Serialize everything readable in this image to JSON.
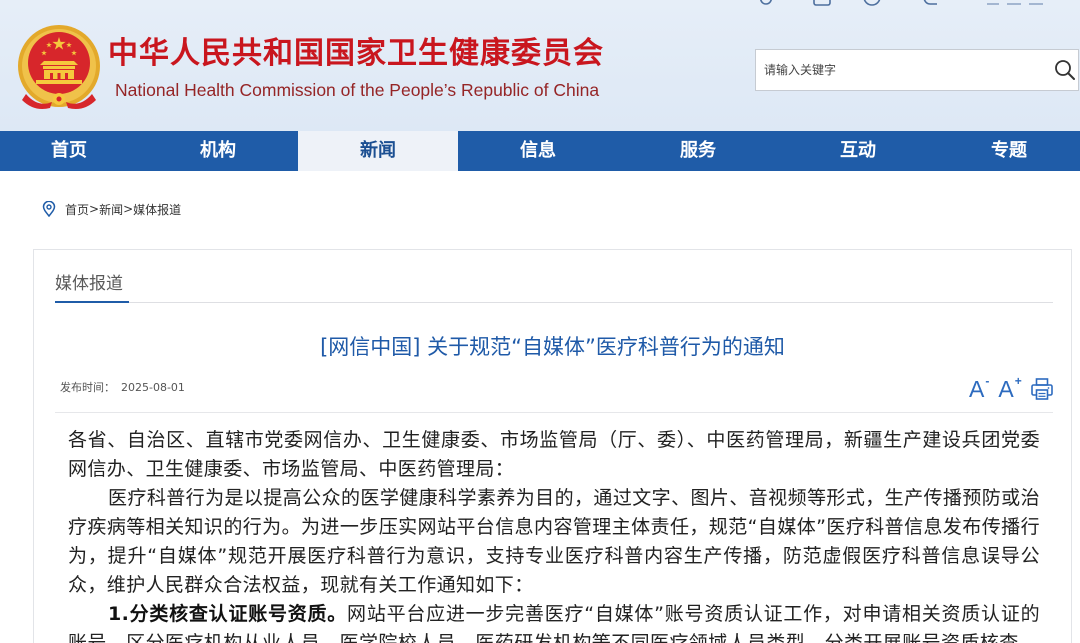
{
  "header": {
    "emblem_icon": "national-emblem-icon",
    "title_cn": "中华人民共和国国家卫生健康委员会",
    "title_en": "National Health Commission of the People’s Republic of China"
  },
  "search": {
    "placeholder": "请输入关键字",
    "icon": "search-icon"
  },
  "nav": {
    "items": [
      {
        "label": "首页"
      },
      {
        "label": "机构"
      },
      {
        "label": "新闻",
        "active": true
      },
      {
        "label": "信息"
      },
      {
        "label": "服务"
      },
      {
        "label": "互动"
      },
      {
        "label": "专题"
      }
    ]
  },
  "breadcrumb": {
    "icon": "location-pin-icon",
    "items": [
      "首页",
      "新闻",
      "媒体报道"
    ],
    "separator": ">"
  },
  "section": {
    "label": "媒体报道"
  },
  "article": {
    "title": "[网信中国] 关于规范“自媒体”医疗科普行为的通知",
    "date_label": "发布时间：",
    "date": "2025-08-01",
    "font_controls": {
      "decrease": {
        "letter": "A",
        "mark": "-"
      },
      "increase": {
        "letter": "A",
        "mark": "+"
      },
      "print_icon": "printer-icon"
    },
    "paragraphs": [
      {
        "text": "各省、自治区、直辖市党委网信办、卫生健康委、市场监管局（厅、委）、中医药管理局，新疆生产建设兵团党委网信办、卫生健康委、市场监管局、中医药管理局："
      },
      {
        "text": "医疗科普行为是以提高公众的医学健康科学素养为目的，通过文字、图片、音视频等形式，生产传播预防或治疗疾病等相关知识的行为。为进一步压实网站平台信息内容管理主体责任，规范“自媒体”医疗科普信息发布传播行为，提升“自媒体”规范开展医疗科普行为意识，支持专业医疗科普内容生产传播，防范虚假医疗科普信息误导公众，维护人民群众合法权益，现就有关工作通知如下："
      },
      {
        "lead": "1.分类核查认证账号资质。",
        "text": "网站平台应进一步完善医疗“自媒体”账号资质认证工作，对申请相关资质认证的账号，区分医疗机构从业人员、医学院校人员、医药研发机构等不同医疗领域人员类型，分类开展账号资质核查"
      }
    ]
  },
  "colors": {
    "brand_red": "#c9161e",
    "subtitle_red": "#952526",
    "nav_blue": "#1f5ca8",
    "active_tab_bg": "#eef2f8",
    "title_blue": "#1f5aa8",
    "control_blue": "#2d6bbf"
  }
}
